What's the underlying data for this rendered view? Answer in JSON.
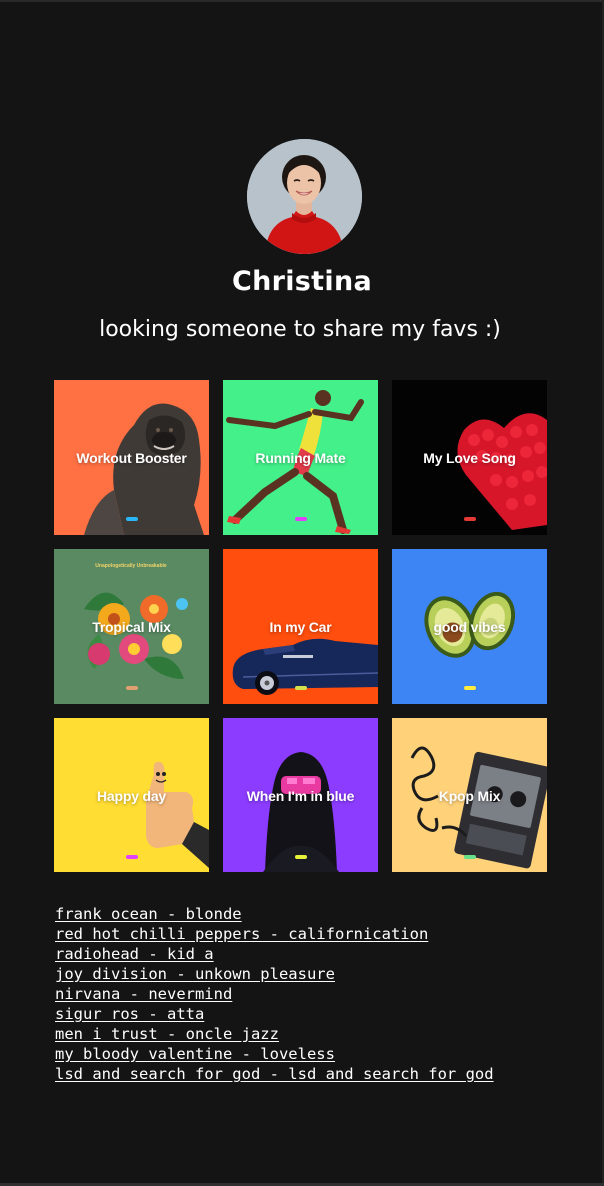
{
  "profile": {
    "name": "Christina",
    "bio": "looking someone to share my favs :)"
  },
  "playlists": [
    {
      "title": "Workout Booster",
      "bg": "#ff7043",
      "pill": "#29b6f6",
      "art": "gorilla-image"
    },
    {
      "title": "Running Mate",
      "bg": "#43f08a",
      "pill": "#e040fb",
      "art": "runner-image"
    },
    {
      "title": "My Love Song",
      "bg": "#030303",
      "pill": "#e53935",
      "art": "rose-heart-image"
    },
    {
      "title": "Tropical Mix",
      "bg": "#5a8a62",
      "pill": "#e0a070",
      "art": "flowers-image"
    },
    {
      "title": "In my Car",
      "bg": "#ff4e0d",
      "pill": "#d4e14c",
      "art": "car-image"
    },
    {
      "title": "good vibes",
      "bg": "#3d85f5",
      "pill": "#ffeb3b",
      "art": "avocado-image"
    },
    {
      "title": "Happy day",
      "bg": "#ffdd33",
      "pill": "#e040fb",
      "art": "thumbs-up-image"
    },
    {
      "title": "When I'm in blue",
      "bg": "#8c3cff",
      "pill": "#e4f03a",
      "art": "hooded-figure-image"
    },
    {
      "title": "Kpop Mix",
      "bg": "#ffd27a",
      "pill": "#66e08a",
      "art": "cassette-image"
    }
  ],
  "tile_small_text": "Unapologetically Unbreakable",
  "albums": [
    "frank ocean - blonde",
    "red hot chilli peppers - californication",
    "radiohead - kid a",
    "joy division - unkown pleasure",
    "nirvana - nevermind",
    "sigur ros - atta",
    "men i trust - oncle jazz",
    "my bloody valentine - loveless",
    "lsd and search for god - lsd and search for god"
  ]
}
